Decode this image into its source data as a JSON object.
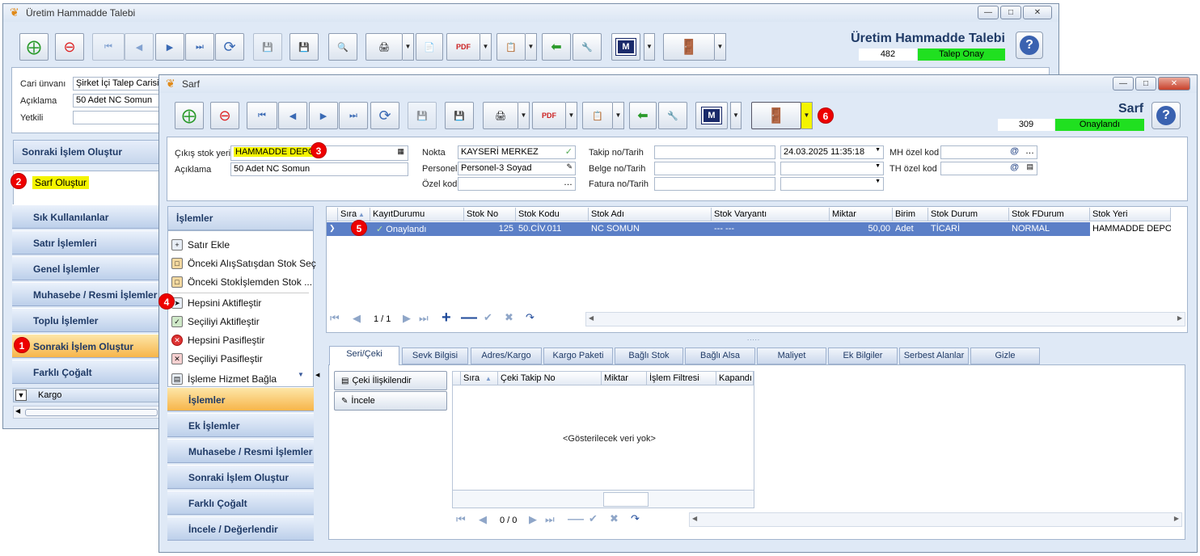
{
  "back_window": {
    "title": "Üretim Hammadde Talebi",
    "header_title": "Üretim Hammadde Talebi",
    "doc_no": "482",
    "status": "Talep Onay",
    "cari_label": "Cari ünvanı",
    "cari_value": "Şirket İçi Talep Carisi",
    "aciklama_label": "Açıklama",
    "aciklama_value": "50 Adet NC Somun",
    "yetkili_label": "Yetkili",
    "section_header": "Sonraki İşlem Oluştur",
    "sarf_olustur": "Sarf Oluştur",
    "nav": [
      "Sık Kullanılanlar",
      "Satır İşlemleri",
      "Genel İşlemler",
      "Muhasebe / Resmi İşlemler",
      "Toplu İşlemler",
      "Sonraki İşlem Oluştur",
      "Farklı Çoğalt"
    ],
    "kargo": "Kargo"
  },
  "front_window": {
    "title": "Sarf",
    "header_title": "Sarf",
    "doc_no": "309",
    "status": "Onaylandı",
    "form": {
      "cikis_label": "Çıkış stok yeri",
      "cikis_value": "HAMMADDE DEPO",
      "aciklama_label": "Açıklama",
      "aciklama_value": "50 Adet NC Somun",
      "nokta_label": "Nokta",
      "nokta_value": "KAYSERİ MERKEZ",
      "personel_label": "Personel",
      "personel_value": "Personel-3 Soyad",
      "ozelkod_label": "Özel kod",
      "takip_label": "Takip no/Tarih",
      "takip_date": "24.03.2025 11:35:18",
      "belge_label": "Belge no/Tarih",
      "fatura_label": "Fatura no/Tarih",
      "mh_label": "MH özel kod",
      "th_label": "TH özel kod"
    },
    "islemler_header": "İşlemler",
    "actions": [
      "Satır Ekle",
      "Önceki AlışSatışdan Stok Seç",
      "Önceki Stokİşlemden Stok ...",
      "Hepsini Aktifleştir",
      "Seçiliyi Aktifleştir",
      "Hepsini Pasifleştir",
      "Seçiliyi Pasifleştir",
      "İşleme Hizmet Bağla"
    ],
    "nav": [
      "İşlemler",
      "Ek İşlemler",
      "Muhasebe / Resmi İşlemler",
      "Sonraki İşlem Oluştur",
      "Farklı Çoğalt",
      "İncele / Değerlendir"
    ],
    "grid": {
      "headers": [
        "Sıra",
        "KayıtDurumu",
        "Stok No",
        "Stok Kodu",
        "Stok Adı",
        "Stok Varyantı",
        "Miktar",
        "Birim",
        "Stok Durum",
        "Stok FDurum",
        "Stok Yeri"
      ],
      "row": [
        "Onaylandı",
        "125",
        "50.CİV.011",
        "NC SOMUN",
        "--- ---",
        "50,00",
        "Adet",
        "TİCARİ",
        "NORMAL",
        "HAMMADDE DEPO"
      ],
      "pager": "1 / 1"
    },
    "tabs": [
      "Seri/Çeki",
      "Sevk Bilgisi",
      "Adres/Kargo",
      "Kargo Paketi",
      "Bağlı Stok",
      "Bağlı Alsa",
      "Maliyet",
      "Ek Bilgiler",
      "Serbest Alanlar",
      "Gizle"
    ],
    "seri": {
      "btn_iliskilendir": "Çeki İlişkilendir",
      "btn_incele": "İncele",
      "headers": [
        "Sıra",
        "Çeki Takip No",
        "Miktar",
        "İşlem Filtresi",
        "Kapandı"
      ],
      "empty": "<Gösterilecek veri yok>",
      "pager": "0 / 0"
    }
  },
  "badges": [
    "1",
    "2",
    "3",
    "4",
    "5",
    "6"
  ],
  "colors": {
    "status_green": "#20e020",
    "highlight": "#f4f400",
    "badge_red": "#e00000",
    "row_select": "#5b7fc7"
  }
}
